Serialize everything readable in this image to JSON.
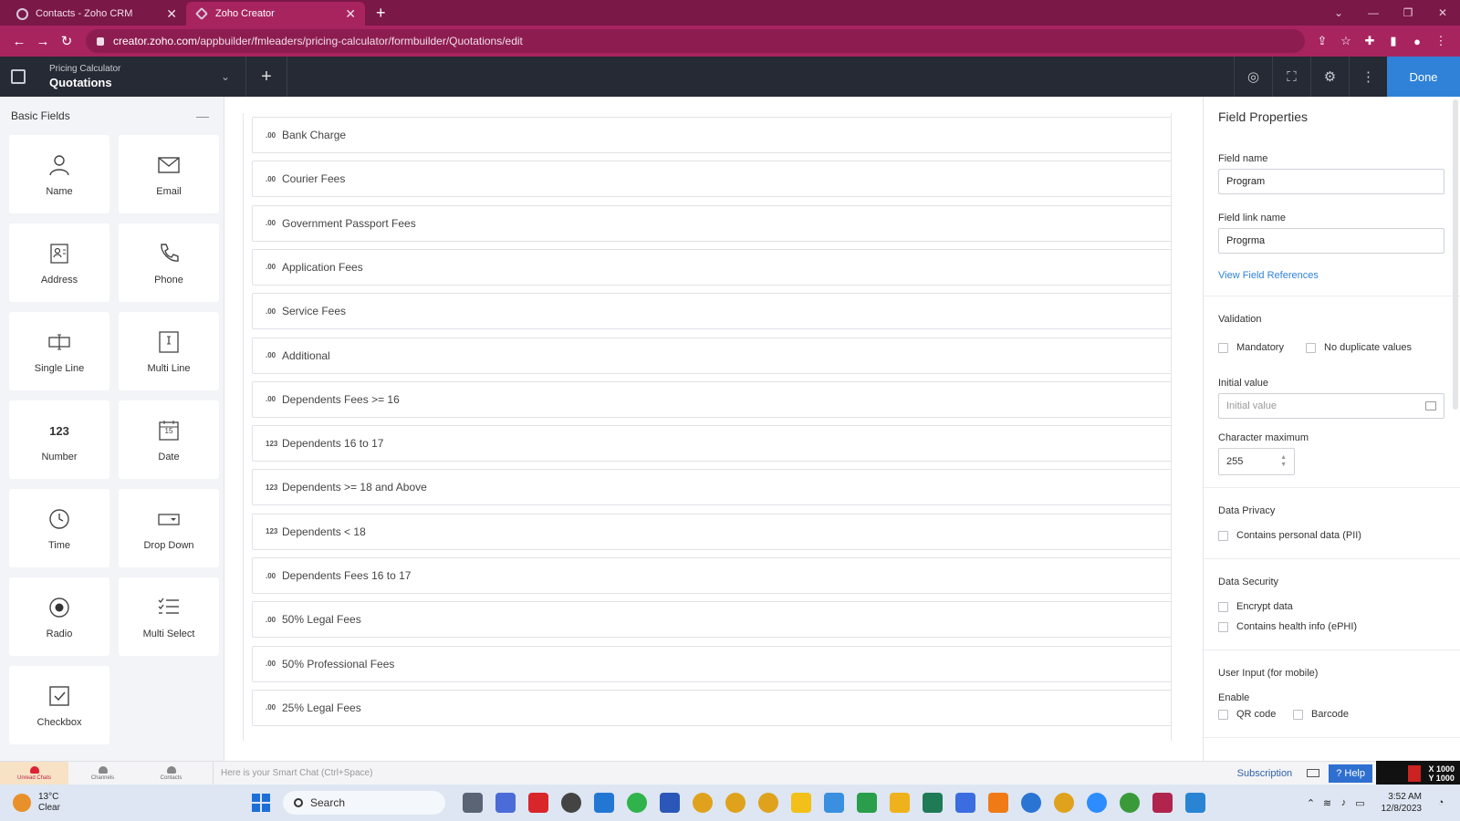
{
  "browser": {
    "tabs": [
      {
        "label": "Contacts - Zoho CRM",
        "icon": "crm-icon",
        "active": false
      },
      {
        "label": "Zoho Creator",
        "icon": "creator-icon",
        "active": true
      }
    ],
    "url_domain": "creator.zoho.com",
    "url_path": "/appbuilder/fmleaders/pricing-calculator/formbuilder/Quotations/edit"
  },
  "app_header": {
    "app_name": "Pricing Calculator",
    "form_name": "Quotations",
    "done_label": "Done"
  },
  "basic_fields": {
    "title": "Basic Fields",
    "items": [
      {
        "label": "Name",
        "icon": "person-icon"
      },
      {
        "label": "Email",
        "icon": "mail-icon"
      },
      {
        "label": "Address",
        "icon": "address-card-icon"
      },
      {
        "label": "Phone",
        "icon": "phone-icon"
      },
      {
        "label": "Single Line",
        "icon": "single-line-icon"
      },
      {
        "label": "Multi Line",
        "icon": "multi-line-icon"
      },
      {
        "label": "Number",
        "icon": "number-icon",
        "glyph": "123"
      },
      {
        "label": "Date",
        "icon": "calendar-icon",
        "glyph": "15"
      },
      {
        "label": "Time",
        "icon": "clock-icon"
      },
      {
        "label": "Drop Down",
        "icon": "dropdown-icon"
      },
      {
        "label": "Radio",
        "icon": "radio-icon"
      },
      {
        "label": "Multi Select",
        "icon": "multi-select-icon"
      },
      {
        "label": "Checkbox",
        "icon": "checkbox-icon"
      }
    ]
  },
  "form_fields": [
    {
      "tag": ".00",
      "label": "Bank Charge"
    },
    {
      "tag": ".00",
      "label": "Courier Fees"
    },
    {
      "tag": ".00",
      "label": "Government Passport Fees"
    },
    {
      "tag": ".00",
      "label": "Application Fees"
    },
    {
      "tag": ".00",
      "label": "Service Fees"
    },
    {
      "tag": ".00",
      "label": "Additional"
    },
    {
      "tag": ".00",
      "label": "Dependents Fees >= 16"
    },
    {
      "tag": "123",
      "label": "Dependents 16 to 17"
    },
    {
      "tag": "123",
      "label": "Dependents >= 18 and Above"
    },
    {
      "tag": "123",
      "label": "Dependents < 18"
    },
    {
      "tag": ".00",
      "label": "Dependents Fees 16 to 17"
    },
    {
      "tag": ".00",
      "label": "50% Legal Fees"
    },
    {
      "tag": ".00",
      "label": "50% Professional Fees"
    },
    {
      "tag": ".00",
      "label": "25% Legal Fees"
    }
  ],
  "field_properties": {
    "title": "Field Properties",
    "field_name_label": "Field name",
    "field_name_value": "Program",
    "field_link_name_label": "Field link name",
    "field_link_name_value": "Progrma",
    "view_references": "View Field References",
    "validation_title": "Validation",
    "mandatory_label": "Mandatory",
    "no_duplicate_label": "No duplicate values",
    "initial_value_label": "Initial value",
    "initial_value_placeholder": "Initial value",
    "char_max_label": "Character maximum",
    "char_max_value": "255",
    "data_privacy_title": "Data Privacy",
    "pii_label": "Contains personal data (PII)",
    "data_security_title": "Data Security",
    "encrypt_label": "Encrypt data",
    "ephi_label": "Contains health info (ePHI)",
    "user_input_title": "User Input (for mobile)",
    "enable_label": "Enable",
    "qr_label": "QR code",
    "barcode_label": "Barcode"
  },
  "chat_bar": {
    "items": [
      {
        "label": "Unread Chats",
        "badge": "1"
      },
      {
        "label": "Channels"
      },
      {
        "label": "Contacts"
      }
    ],
    "placeholder": "Here is your Smart Chat (Ctrl+Space)",
    "subscription": "Subscription",
    "help": "Help",
    "coords_x": "X 1000",
    "coords_y": "Y 1000"
  },
  "taskbar": {
    "temperature": "13°C",
    "condition": "Clear",
    "search_label": "Search",
    "time": "3:52 AM",
    "date": "12/8/2023"
  },
  "colors": {
    "browser_tab_bg": "#7a1848",
    "browser_active": "#a8245f",
    "app_header": "#262a34",
    "accent": "#2f82d8"
  }
}
